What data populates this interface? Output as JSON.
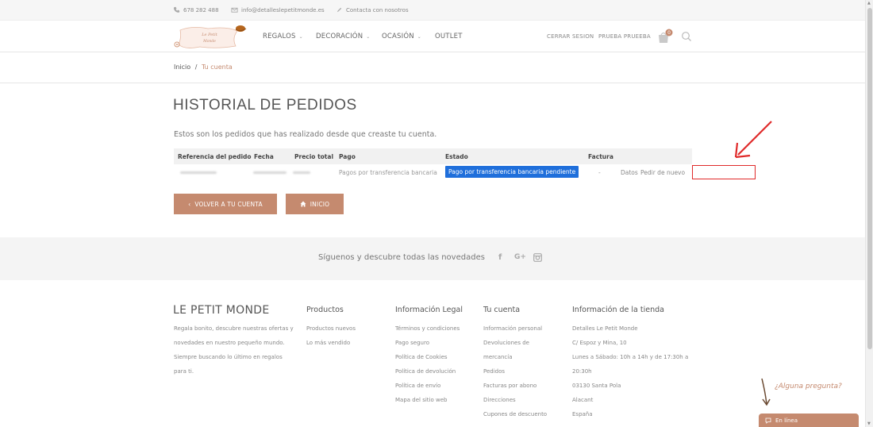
{
  "topbar": {
    "phone": "678 282 488",
    "email": "info@detalleslepetitmonde.es",
    "contact": "Contacta con nosotros"
  },
  "logo": {
    "line1": "Le Petit",
    "line2": "Monde"
  },
  "nav": {
    "items": [
      "REGALOS",
      "DECORACIÓN",
      "OCASIÓN",
      "OUTLET"
    ],
    "logout": "CERRAR SESION",
    "user": "PRUEBA PRUEEBA",
    "cart_count": "0"
  },
  "breadcrumb": {
    "home": "Inicio",
    "separator": "/",
    "current": "Tu cuenta"
  },
  "page": {
    "title": "HISTORIAL DE PEDIDOS",
    "intro": "Estos son los pedidos que has realizado desde que creaste tu cuenta."
  },
  "orders": {
    "headers": [
      "Referencia del pedido",
      "Fecha",
      "Precio total",
      "Pago",
      "Estado",
      "Factura"
    ],
    "rows": [
      {
        "pago": "Pagos por transferencia bancaria",
        "estado": "Pago por transferencia bancaria pendiente",
        "factura": "-",
        "details": "Datos",
        "reorder": "Pedir de nuevo"
      }
    ]
  },
  "buttons": {
    "back": "VOLVER A TU CUENTA",
    "home": "INICIO"
  },
  "social": {
    "text": "Síguenos y descubre todas las novedades",
    "facebook": "f",
    "gplus": "G+"
  },
  "footer": {
    "brand": {
      "title": "LE PETIT MONDE",
      "lines": [
        "Regala bonito, descubre nuestras ofertas y",
        "novedades en nuestro pequeño mundo.",
        "Siempre buscando lo último en regalos",
        "para ti."
      ]
    },
    "productos": {
      "title": "Productos",
      "links": [
        "Productos nuevos",
        "Lo más vendido"
      ]
    },
    "legal": {
      "title": "Información Legal",
      "links": [
        "Términos y condiciones",
        "Pago seguro",
        "Política de Cookies",
        "Política de devolución",
        "Política de envío",
        "Mapa del sitio web"
      ]
    },
    "cuenta": {
      "title": "Tu cuenta",
      "links": [
        "Información personal",
        "Devoluciones de",
        "mercancía",
        "Pedidos",
        "Facturas por abono",
        "Direcciones",
        "Cupones de descuento"
      ]
    },
    "tienda": {
      "title": "Información de la tienda",
      "lines": [
        "Detalles Le Petit Monde",
        "C/ Espoz y Mina, 10",
        "Lunes a Sábado: 10h a 14h y de 17:30h a",
        "20:30h",
        "03130 Santa Pola",
        "Alacant",
        "España"
      ]
    }
  },
  "chat": {
    "prompt": "¿Alguna pregunta?",
    "status": "En línea"
  },
  "colors": {
    "accent": "#c58a6f",
    "badge": "#1f6fdb",
    "highlight": "#e02a2a"
  }
}
